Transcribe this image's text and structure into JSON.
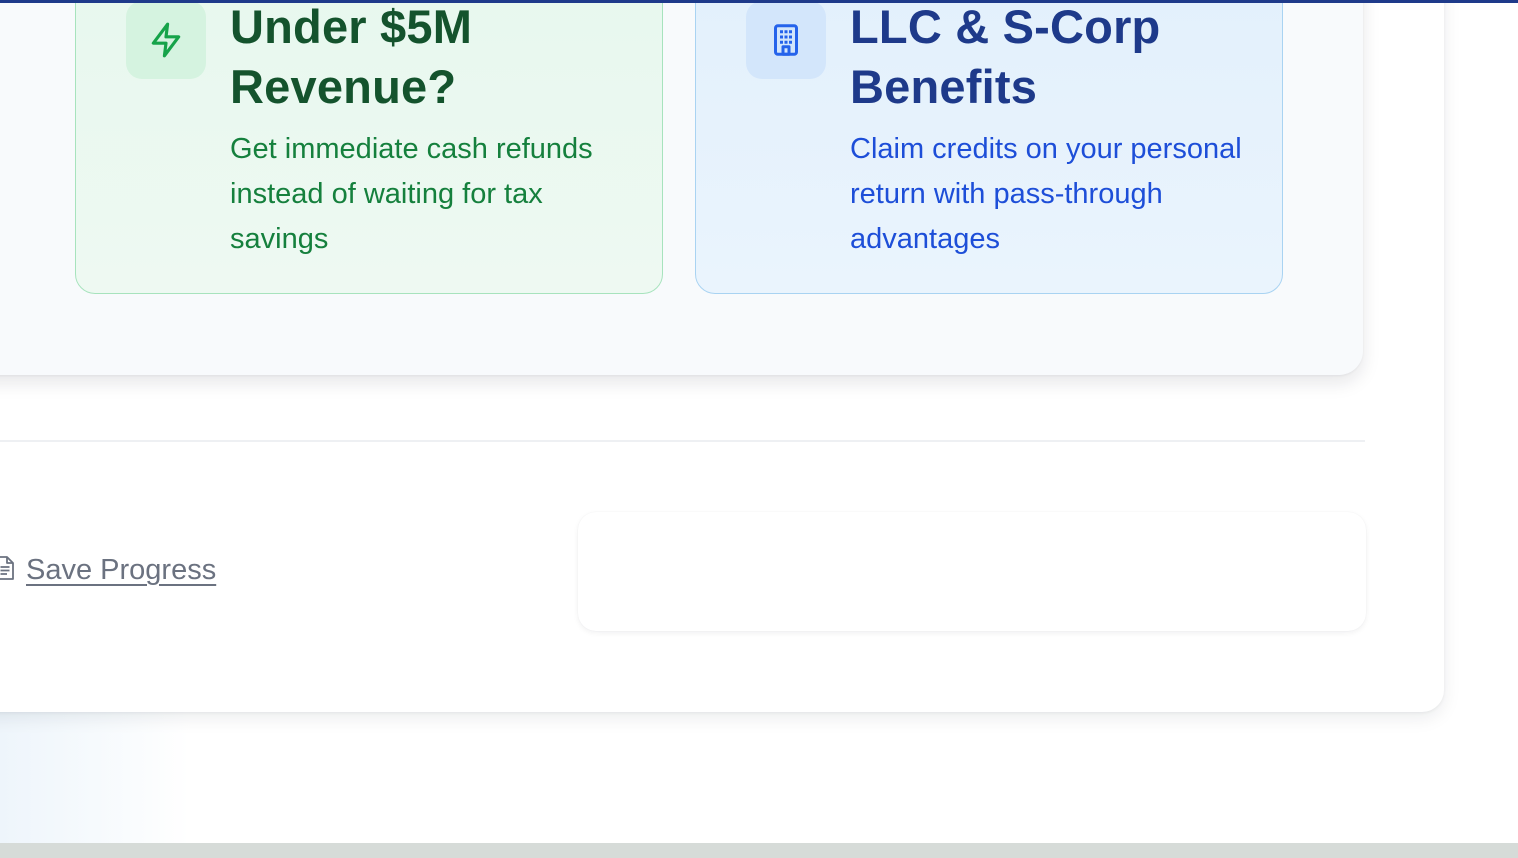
{
  "benefits": {
    "revenue": {
      "title": "Under $5M Revenue?",
      "description": "Get immediate cash refunds instead of waiting for tax savings",
      "icon": "lightning-icon",
      "accent": "#16a34a"
    },
    "entity": {
      "title": "LLC & S-Corp Benefits",
      "description": "Claim credits on your personal return with pass-through advantages",
      "icon": "building-icon",
      "accent": "#2563eb"
    }
  },
  "footer": {
    "save_label": "Save Progress",
    "save_icon": "document-icon"
  }
}
